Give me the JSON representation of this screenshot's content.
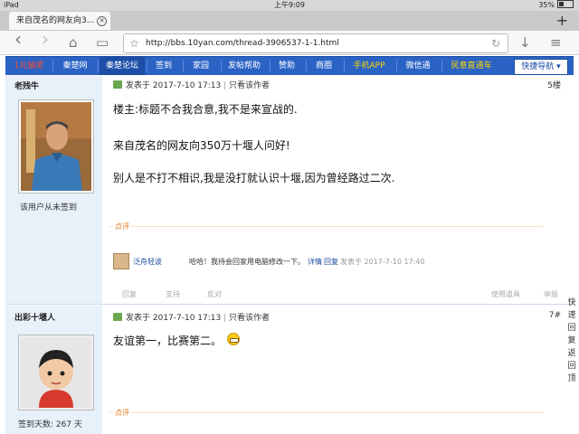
{
  "status": {
    "device": "iPad",
    "wifi_icon": "wifi-icon",
    "time": "上午9:09",
    "battery": "35%"
  },
  "tab": {
    "title": "来自茂名的网友向3...",
    "close": "✕",
    "new_tab": "+"
  },
  "nav": {
    "back": "‹",
    "forward": "›",
    "home": "⌂",
    "tabs": "▭",
    "url": "http://bbs.10yan.com/thread-3906537-1-1.html",
    "star": "☆",
    "refresh": "↻",
    "download": "↓",
    "menu": "≡"
  },
  "sitenav": {
    "items": [
      "1元抽奖",
      "秦楚网",
      "秦楚论坛",
      "签到",
      "家园",
      "发帖帮助",
      "赞助",
      "商圈",
      "手机APP",
      "微信通",
      "民意直通车"
    ],
    "quick": "快捷导航 ▾"
  },
  "posts": [
    {
      "author": "老残牛",
      "sign": "该用户从未签到",
      "meta": "发表于 2017-7-10 17:13",
      "only_author": "只看该作者",
      "floor": "5楼",
      "lines": [
        "楼主:标题不合我合意,我不是来宣战的.",
        "来自茂名的网友向350万十堰人问好!",
        "别人是不打不相识,我是没打就认识十堰,因为曾经路过二次."
      ],
      "comment_label": "点评",
      "comment": {
        "user": "泛舟轻波",
        "text": "哈哈！我待会回家用电脑修改一下。",
        "detail": "详情",
        "reply": "回复",
        "time": "发表于 2017-7-10 17:40"
      },
      "actions": [
        "回复",
        "支持",
        "反对",
        "使用道具",
        "举报"
      ]
    },
    {
      "author": "出彩十堰人",
      "sign": "签到天数: 267 天",
      "meta": "发表于 2017-7-10 17:13",
      "only_author": "只看该作者",
      "floor": "7#",
      "lines": [
        "友谊第一，比赛第二。"
      ],
      "comment_label": "点评"
    }
  ],
  "side": "快速回复返回顶"
}
